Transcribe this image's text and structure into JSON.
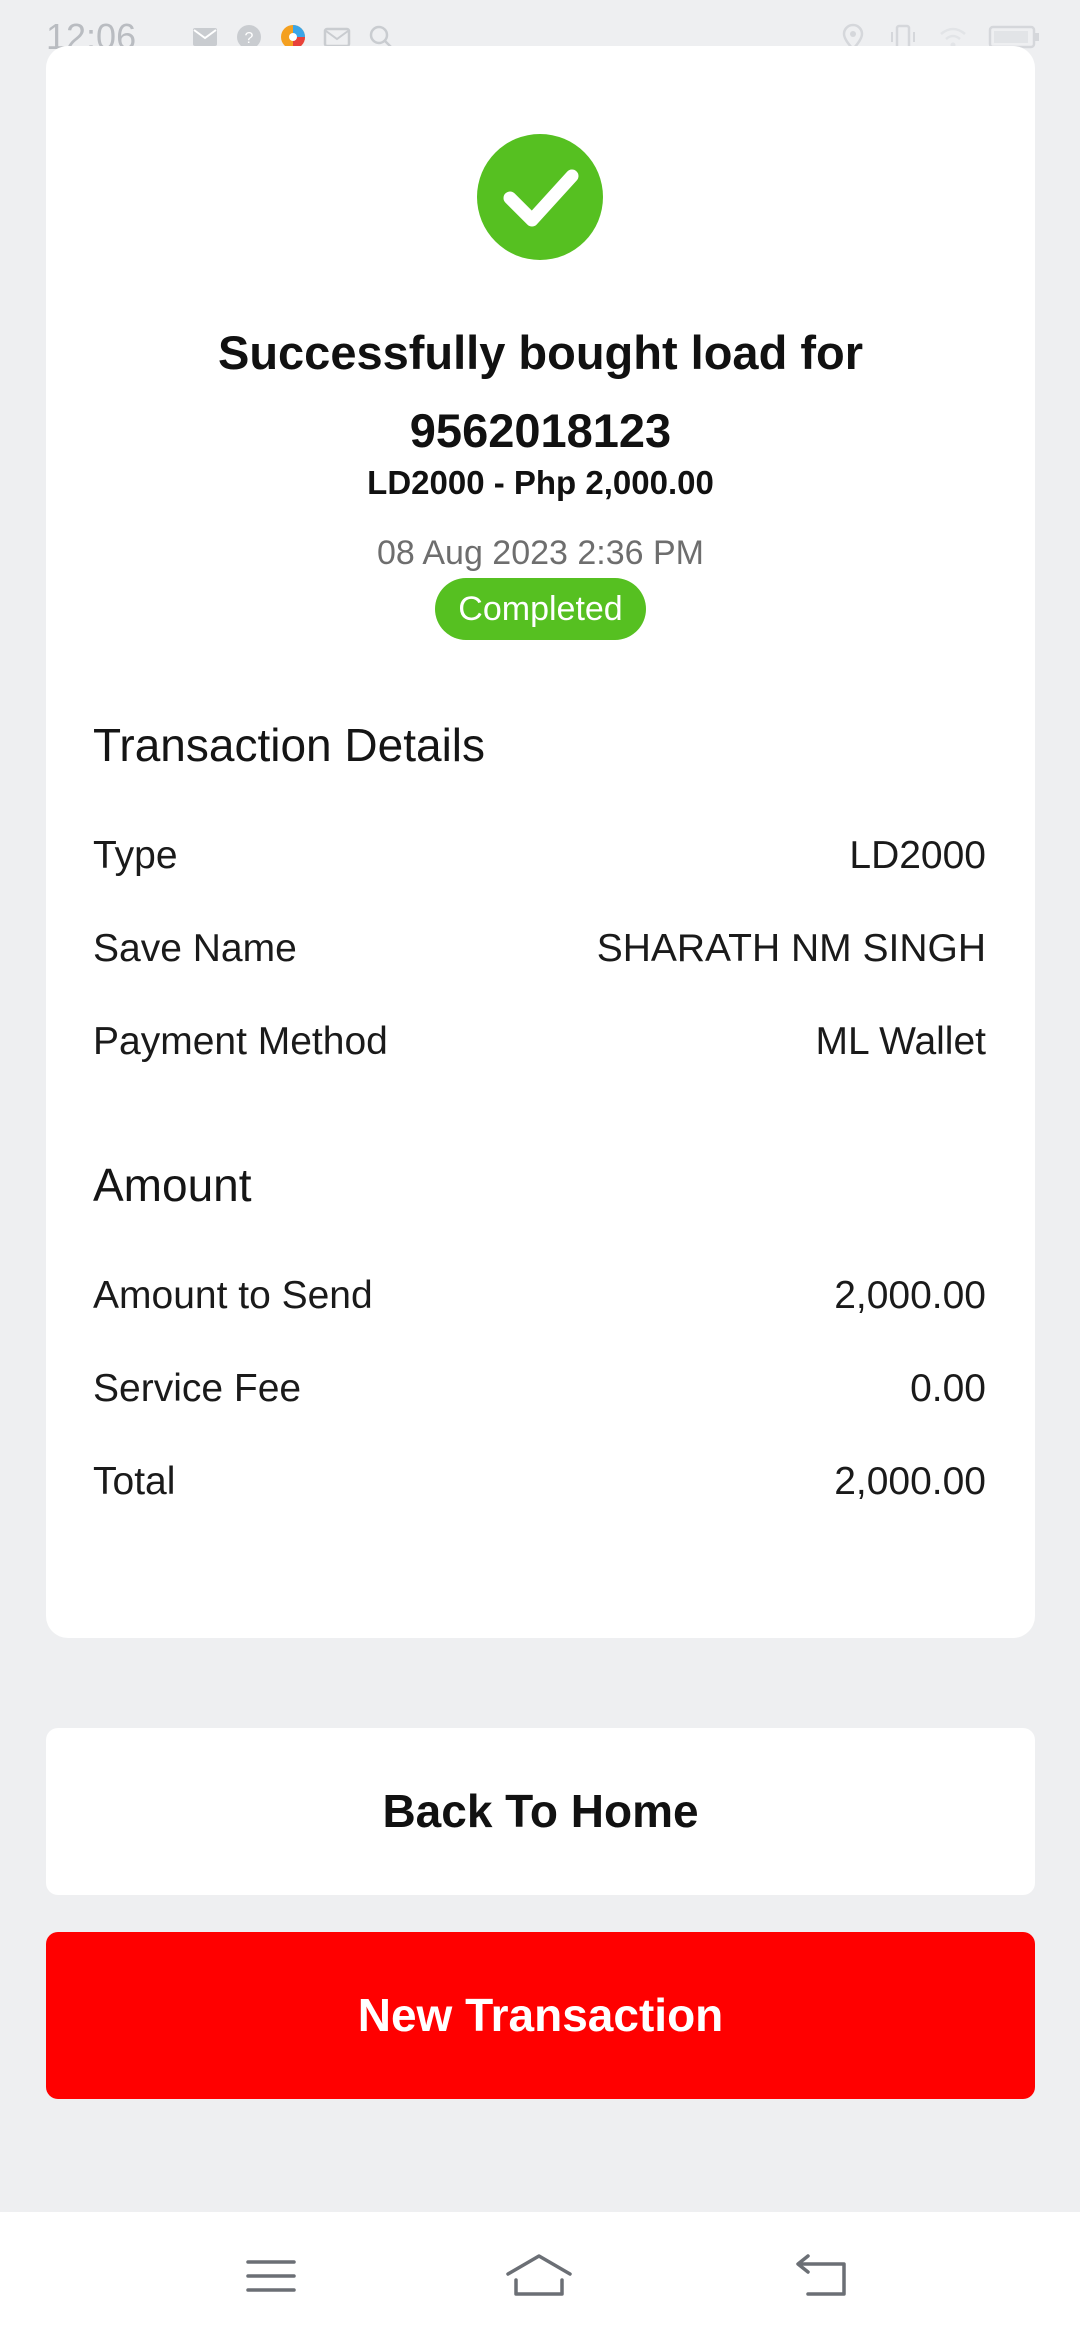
{
  "status_bar": {
    "time": "12:06"
  },
  "receipt": {
    "title_line1": "Successfully bought load for",
    "title_line2": "9562018123",
    "load_code": "LD2000",
    "load_separator": " - ",
    "load_amount": "Php 2,000.00",
    "date": "08 Aug 2023 2:36 PM",
    "status": "Completed",
    "success_color": "#56c021"
  },
  "transaction_details": {
    "heading": "Transaction Details",
    "rows": [
      {
        "label": "Type",
        "value": "LD2000"
      },
      {
        "label": "Save Name",
        "value": "SHARATH NM SINGH"
      },
      {
        "label": "Payment Method",
        "value": "ML Wallet"
      }
    ]
  },
  "amount": {
    "heading": "Amount",
    "rows": [
      {
        "label": "Amount to Send",
        "value": "2,000.00"
      },
      {
        "label": "Service Fee",
        "value": "0.00"
      },
      {
        "label": "Total",
        "value": "2,000.00"
      }
    ]
  },
  "buttons": {
    "back_home": "Back To Home",
    "new_transaction": "New Transaction",
    "new_transaction_color": "#ff0000"
  },
  "nav_bar": {
    "icons": [
      "menu-icon",
      "home-icon",
      "back-icon"
    ]
  }
}
